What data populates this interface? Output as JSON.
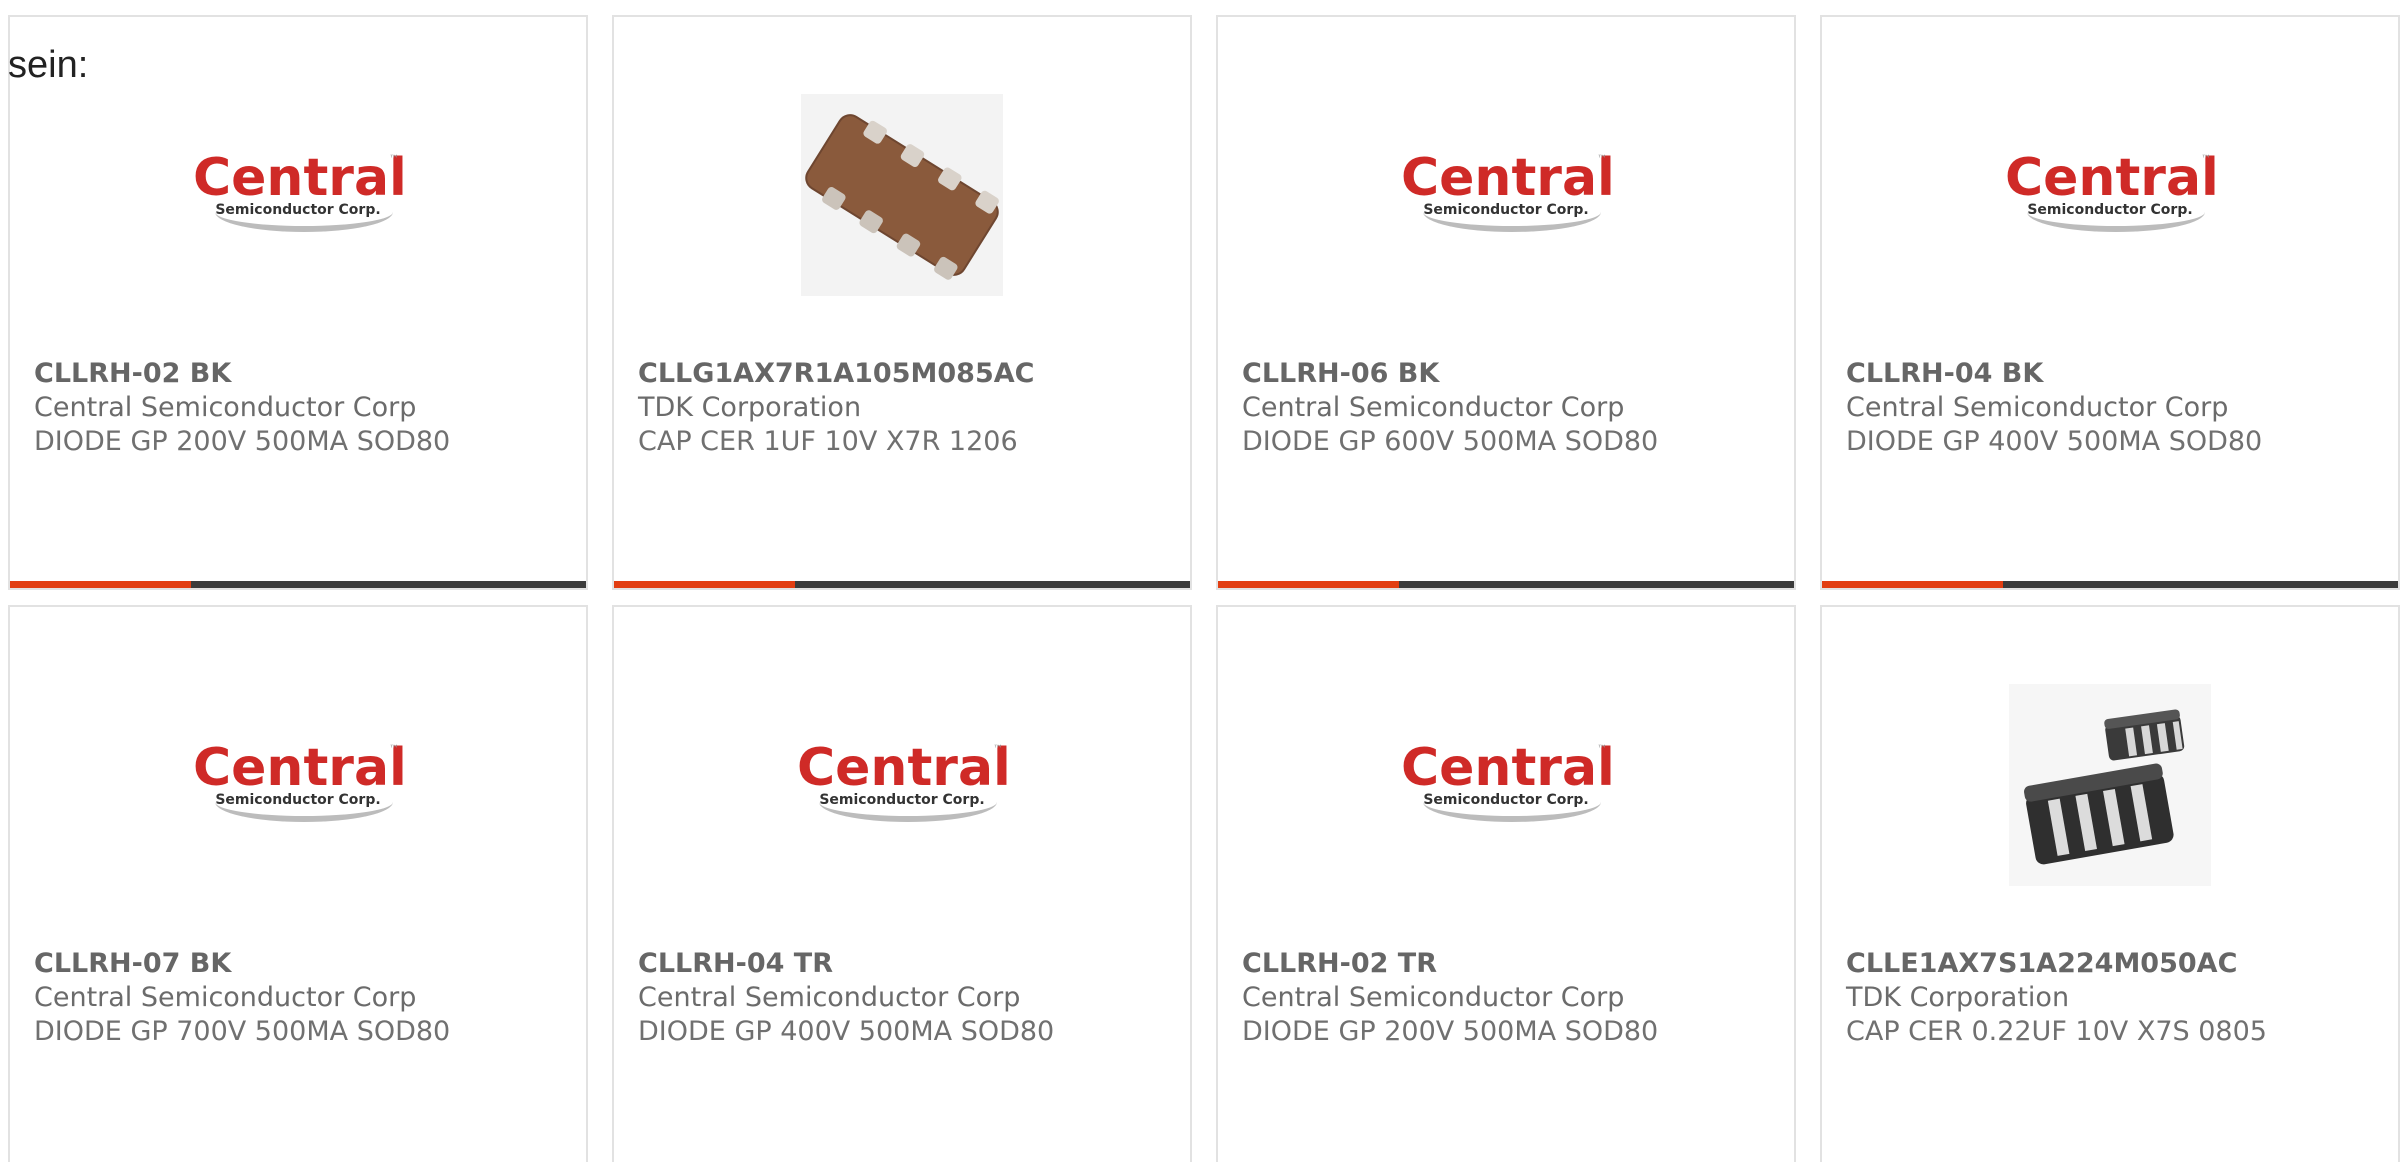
{
  "lead_text": "sein:",
  "logo": {
    "brand": "Central",
    "tagline": "Semiconductor Corp.",
    "trademark": "™"
  },
  "colors": {
    "accent": "#e23e12",
    "bar": "#3b3b3b",
    "brand_red": "#cf2a27"
  },
  "products": [
    {
      "part_number": "CLLRH-02 BK",
      "manufacturer": "Central Semiconductor Corp",
      "description": "DIODE GP 200V 500MA SOD80",
      "image": "central-logo",
      "has_accent_bar": true
    },
    {
      "part_number": "CLLG1AX7R1A105M085AC",
      "manufacturer": "TDK Corporation",
      "description": "CAP CER 1UF 10V X7R 1206",
      "image": "capacitor-array-brown",
      "has_accent_bar": true
    },
    {
      "part_number": "CLLRH-06 BK",
      "manufacturer": "Central Semiconductor Corp",
      "description": "DIODE GP 600V 500MA SOD80",
      "image": "central-logo",
      "has_accent_bar": true
    },
    {
      "part_number": "CLLRH-04 BK",
      "manufacturer": "Central Semiconductor Corp",
      "description": "DIODE GP 400V 500MA SOD80",
      "image": "central-logo",
      "has_accent_bar": true
    },
    {
      "part_number": "CLLRH-07 BK",
      "manufacturer": "Central Semiconductor Corp",
      "description": "DIODE GP 700V 500MA SOD80",
      "image": "central-logo",
      "has_accent_bar": false
    },
    {
      "part_number": "CLLRH-04 TR",
      "manufacturer": "Central Semiconductor Corp",
      "description": "DIODE GP 400V 500MA SOD80",
      "image": "central-logo",
      "has_accent_bar": false
    },
    {
      "part_number": "CLLRH-02 TR",
      "manufacturer": "Central Semiconductor Corp",
      "description": "DIODE GP 200V 500MA SOD80",
      "image": "central-logo",
      "has_accent_bar": false
    },
    {
      "part_number": "CLLE1AX7S1A224M050AC",
      "manufacturer": "TDK Corporation",
      "description": "CAP CER 0.22UF 10V X7S 0805",
      "image": "capacitor-array-black",
      "has_accent_bar": false
    }
  ]
}
